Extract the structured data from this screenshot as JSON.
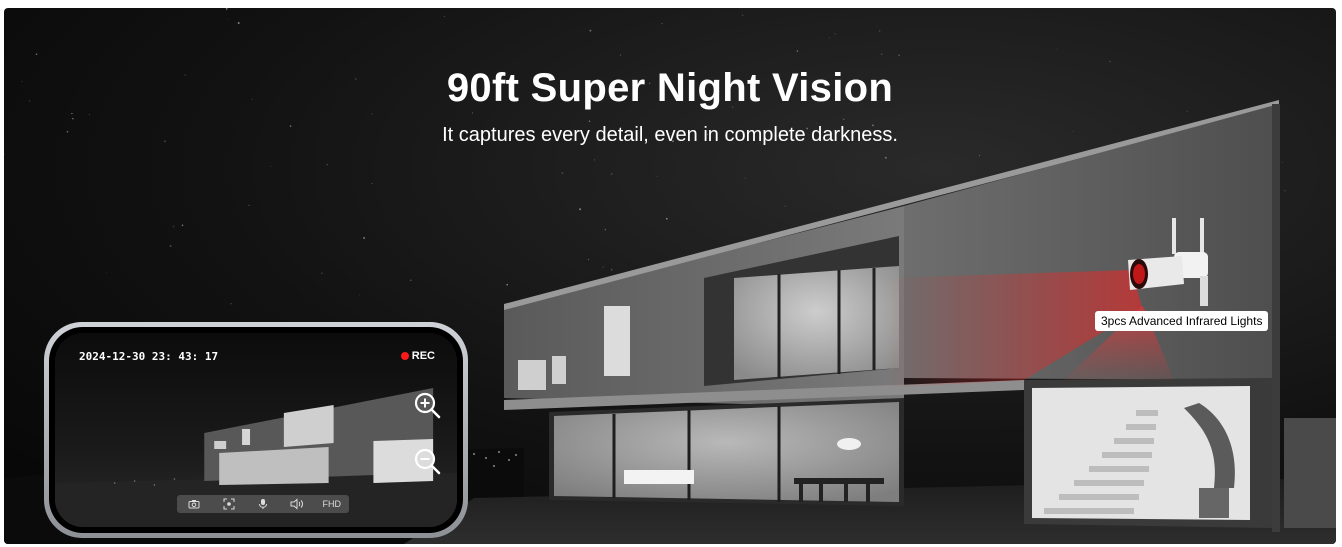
{
  "banner": {
    "headline": "90ft Super Night Vision",
    "subline": "It captures every detail, even in complete darkness.",
    "camera_callout": "3pcs Advanced Infrared Lights",
    "colors": {
      "background": "#0e0e0e",
      "ir_beam": "#ff2a2a",
      "text": "#ffffff"
    }
  },
  "phone": {
    "timestamp": "2024-12-30  23: 43: 17",
    "rec_label": "REC",
    "controls": [
      {
        "icon": "camera-icon"
      },
      {
        "icon": "screenshot-icon"
      },
      {
        "icon": "microphone-icon"
      },
      {
        "icon": "speaker-icon"
      },
      {
        "icon": "resolution",
        "label": "FHD"
      }
    ],
    "zoom_in_icon": "zoom-in-icon",
    "zoom_out_icon": "zoom-out-icon"
  }
}
